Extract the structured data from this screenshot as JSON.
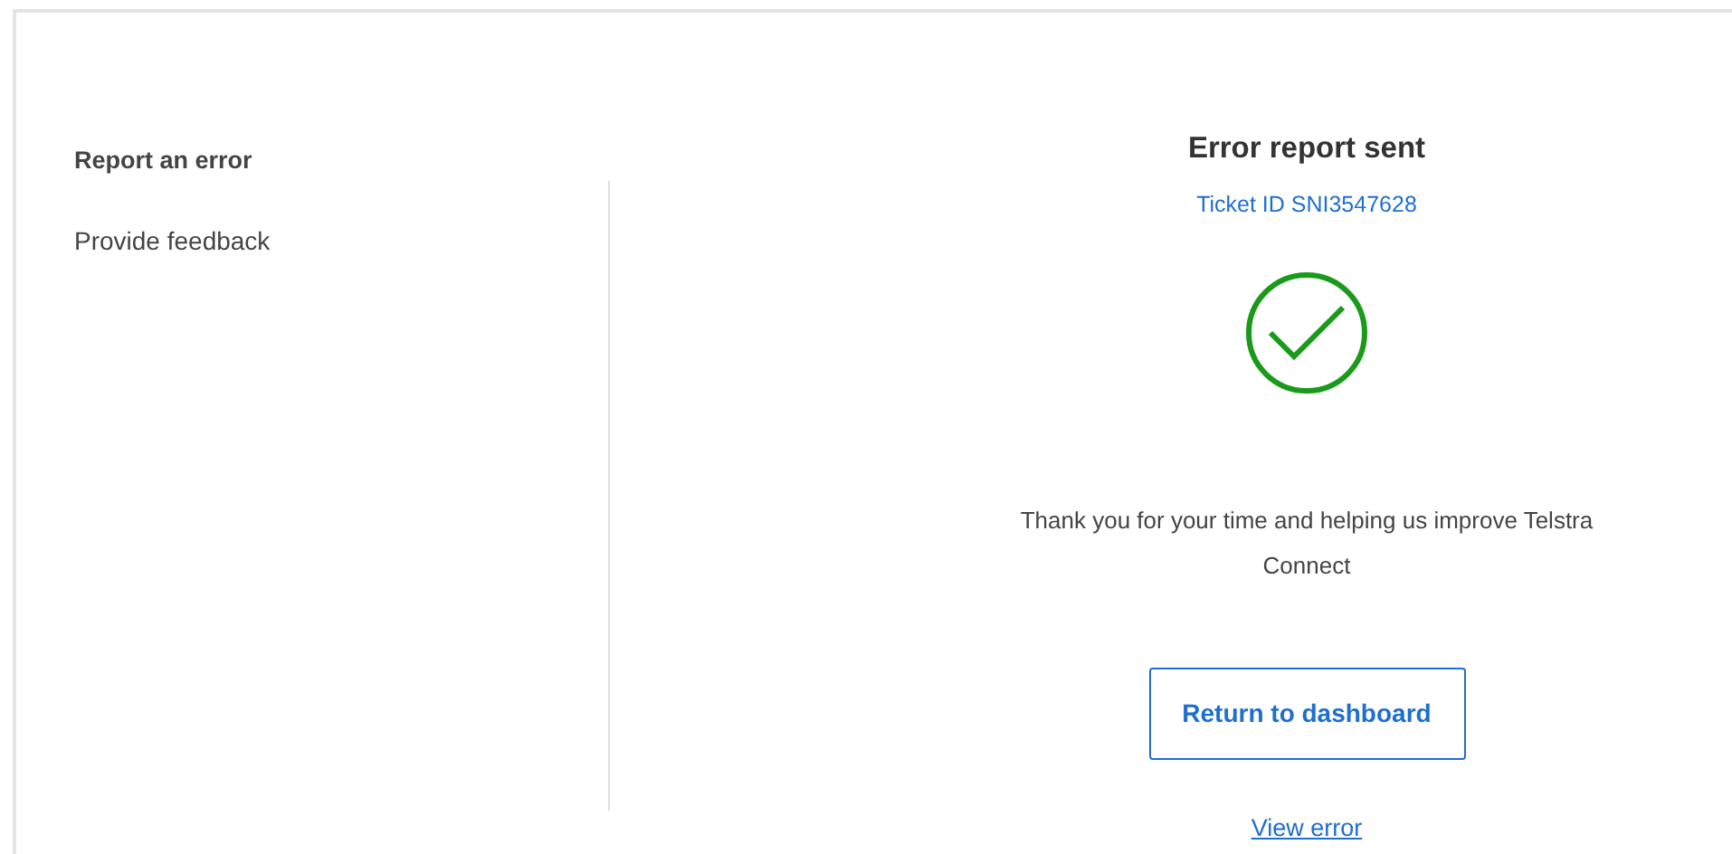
{
  "sidebar": {
    "items": [
      {
        "label": "Report an error",
        "selected": true
      },
      {
        "label": "Provide feedback",
        "selected": false
      }
    ]
  },
  "result": {
    "title": "Error report sent",
    "ticket": "Ticket ID SNI3547628",
    "success": true,
    "message": "Thank you for your time and helping us improve Telstra Connect",
    "button": "Return to dashboard",
    "link": "View error"
  }
}
